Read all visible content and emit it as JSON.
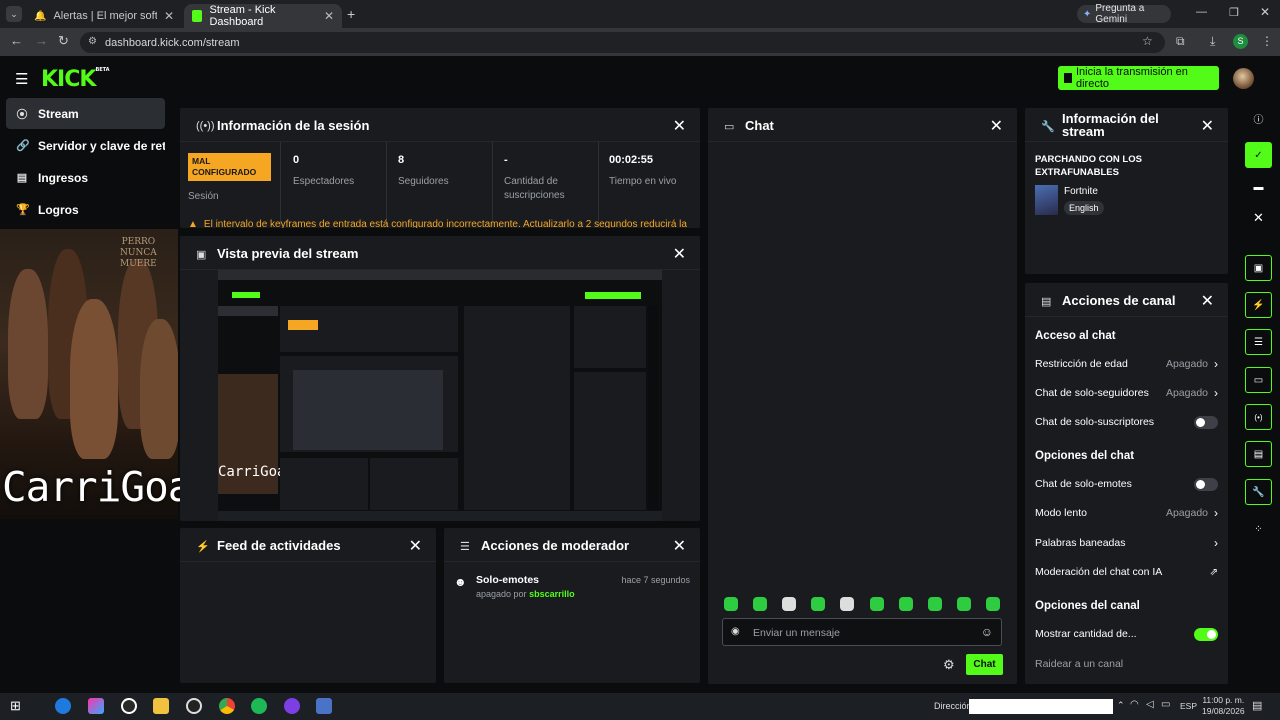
{
  "browser": {
    "tabs": [
      {
        "title": "Alertas | El mejor software para",
        "active": false
      },
      {
        "title": "Stream - Kick Dashboard",
        "active": true
      }
    ],
    "new_tab": "+",
    "gemini": "Pregunta a Gemini",
    "url": "dashboard.kick.com/stream",
    "profile_initial": "S"
  },
  "header": {
    "logo": "KICK",
    "logo_badge": "BETA",
    "go_live": "Inicia la transmisión en directo"
  },
  "sidebar": {
    "items": [
      {
        "label": "Stream",
        "icon": "stream-icon",
        "active": true
      },
      {
        "label": "Servidor y clave de retransmisión",
        "icon": "key-icon"
      },
      {
        "label": "Ingresos",
        "icon": "chart-icon"
      },
      {
        "label": "Logros",
        "icon": "trophy-icon"
      }
    ]
  },
  "webcam": {
    "name": "CarriGoat"
  },
  "session": {
    "title": "Información de la sesión",
    "status_badge": "MAL CONFIGURADO",
    "status_label": "Sesión",
    "stats": [
      {
        "value": "0",
        "label": "Espectadores"
      },
      {
        "value": "8",
        "label": "Seguidores"
      },
      {
        "value": "-",
        "label": "Cantidad de suscripciones"
      },
      {
        "value": "00:02:55",
        "label": "Tiempo en vivo"
      }
    ],
    "warning": "El intervalo de keyframes de entrada está configurado incorrectamente. Actualizarlo a 2 segundos reducirá la"
  },
  "preview": {
    "title": "Vista previa del stream"
  },
  "activity": {
    "title": "Feed de actividades"
  },
  "modactions": {
    "title": "Acciones de moderador",
    "items": [
      {
        "action": "Solo-emotes",
        "time": "hace 7 segundos",
        "detail_prefix": "apagado por",
        "user": "sbscarrillo"
      }
    ]
  },
  "chat": {
    "title": "Chat",
    "placeholder": "Enviar un mensaje",
    "send": "Chat"
  },
  "stream_info": {
    "title": "Información del stream",
    "stream_title": "PARCHANDO CON LOS EXTRAFUNABLES",
    "category": "Fortnite",
    "language": "English"
  },
  "channel_actions": {
    "title": "Acciones de canal",
    "sections": [
      {
        "heading": "Acceso al chat",
        "rows": [
          {
            "label": "Restricción de edad",
            "value": "Apagado",
            "kind": "link"
          },
          {
            "label": "Chat de solo-seguidores",
            "value": "Apagado",
            "kind": "link"
          },
          {
            "label": "Chat de solo-suscriptores",
            "kind": "toggle",
            "on": false
          }
        ]
      },
      {
        "heading": "Opciones del chat",
        "rows": [
          {
            "label": "Chat de solo-emotes",
            "kind": "toggle",
            "on": false
          },
          {
            "label": "Modo lento",
            "value": "Apagado",
            "kind": "link"
          },
          {
            "label": "Palabras baneadas",
            "kind": "link"
          },
          {
            "label": "Moderación del chat con IA",
            "kind": "external"
          }
        ]
      },
      {
        "heading": "Opciones del canal",
        "rows": [
          {
            "label": "Mostrar cantidad de...",
            "kind": "toggle",
            "on": true
          },
          {
            "label": "Raidear a un canal",
            "kind": "muted"
          }
        ]
      }
    ]
  },
  "taskbar": {
    "search_label": "Dirección",
    "lang": "ESP",
    "time": "11:00 p. m.",
    "date": "19/08/2026"
  },
  "colors": {
    "accent": "#53fc18",
    "panel": "#191b1f",
    "warning": "#f5a623"
  }
}
